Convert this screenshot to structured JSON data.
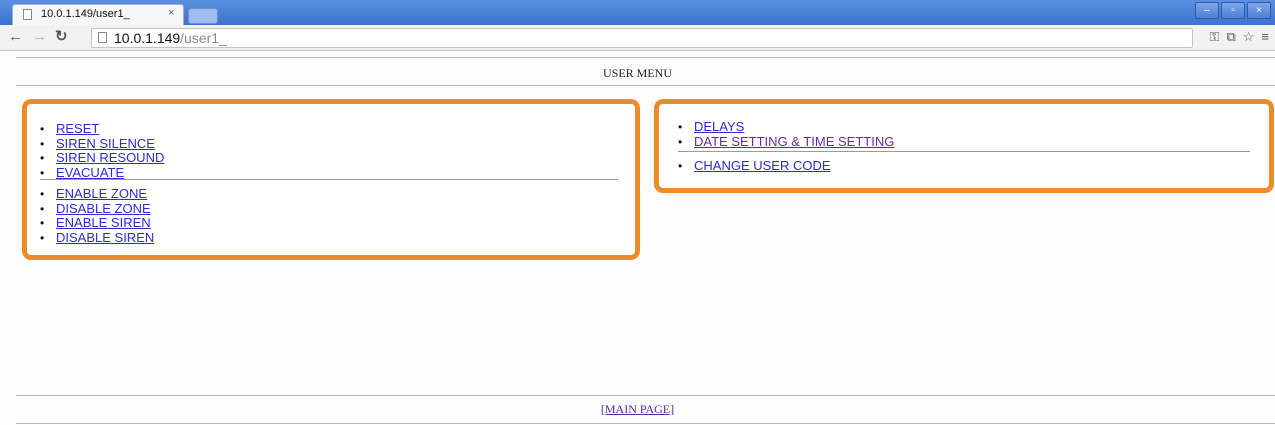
{
  "browser": {
    "tab_title": "10.0.1.149/user1_",
    "tab_close": "×",
    "url_host": "10.0.1.149",
    "url_path": "/user1_",
    "window_controls": [
      "–",
      "▫",
      "×"
    ]
  },
  "page": {
    "menu_title": "USER MENU",
    "left_panel": {
      "group1": [
        "RESET",
        "SIREN SILENCE",
        "SIREN RESOUND",
        "EVACUATE"
      ],
      "group2": [
        "ENABLE ZONE",
        "DISABLE ZONE",
        "ENABLE SIREN",
        "DISABLE SIREN"
      ]
    },
    "right_panel": {
      "group1": [
        "DELAYS",
        "DATE SETTING & TIME SETTING"
      ],
      "group2": [
        "CHANGE USER CODE"
      ]
    },
    "footer_link": "[MAIN PAGE]"
  },
  "colors": {
    "panel_border": "#ef8a2a",
    "link": "#2c2ccf",
    "visited_link": "#6b2a9a"
  }
}
